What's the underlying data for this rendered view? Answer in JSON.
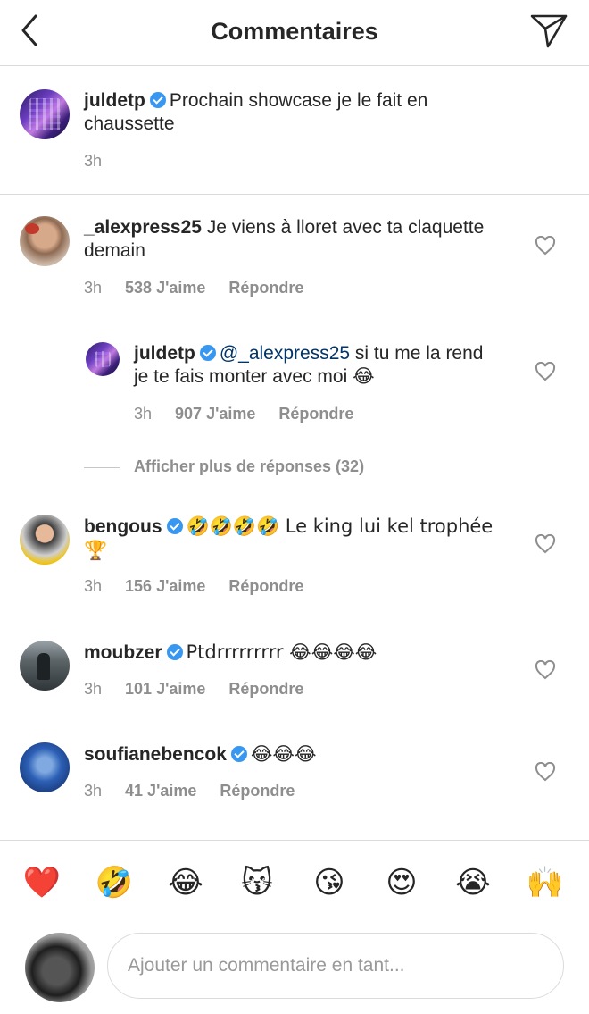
{
  "header": {
    "title": "Commentaires",
    "back_icon": "chevron-left-icon",
    "send_icon": "paper-plane-icon"
  },
  "caption": {
    "username": "juldetp",
    "verified": true,
    "text": "Prochain showcase je le fait en chaussette",
    "time": "3h"
  },
  "comments": [
    {
      "username": "_alexpress25",
      "verified": false,
      "text": "Je viens à lloret avec ta claquette demain",
      "time": "3h",
      "likes": "538 J'aime",
      "reply": "Répondre"
    },
    {
      "username": "juldetp",
      "verified": true,
      "mention": "@_alexpress25",
      "text": "si tu me la rend je te fais monter avec moi 😂",
      "time": "3h",
      "likes": "907 J'aime",
      "reply": "Répondre"
    },
    {
      "username": "bengous",
      "verified": true,
      "text": "🤣🤣🤣🤣 Le king lui kel trophée 🏆",
      "time": "3h",
      "likes": "156 J'aime",
      "reply": "Répondre"
    },
    {
      "username": "moubzer",
      "verified": true,
      "text": "Ptdrrrrrrrrr 😂😂😂😂",
      "time": "3h",
      "likes": "101 J'aime",
      "reply": "Répondre"
    },
    {
      "username": "soufianebencok",
      "verified": true,
      "text": "😂😂😂",
      "time": "3h",
      "likes": "41 J'aime",
      "reply": "Répondre"
    }
  ],
  "more_replies": "Afficher plus de réponses (32)",
  "emoji_bar": [
    "❤️",
    "🤣",
    "😂",
    "😽",
    "😘",
    "😍",
    "😭",
    "🙌"
  ],
  "composer": {
    "placeholder": "Ajouter un commentaire en tant..."
  },
  "colors": {
    "verified": "#3897f0",
    "mention": "#003569",
    "meta": "#8e8e8e",
    "divider": "#dbdbdb"
  }
}
